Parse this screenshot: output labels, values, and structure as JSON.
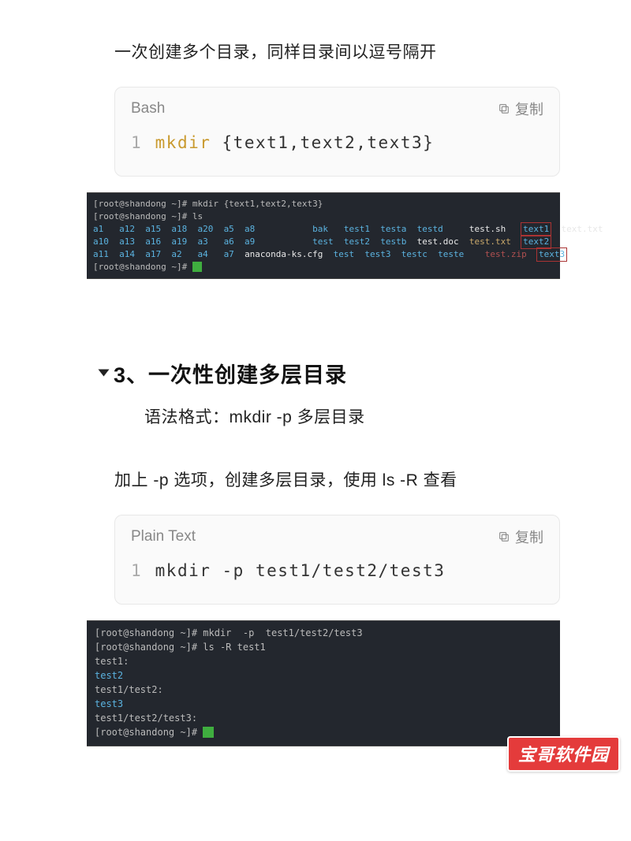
{
  "intro1": "一次创建多个目录，同样目录间以逗号隔开",
  "block1": {
    "lang": "Bash",
    "copy": "复制",
    "lineNo": "1",
    "cmd": "mkdir",
    "args": "{text1,text2,text3}"
  },
  "term1": {
    "l1": "[root@shandong ~]# mkdir {text1,text2,text3}",
    "l2": "[root@shandong ~]# ls",
    "row1": {
      "dirs": "a1   a12  a15  a18  a20  a5  a8           ",
      "bak": "bak   ",
      "t": "test1  testa  testd     ",
      "w": "test.sh   ",
      "hl": "text1",
      "end": "  text.txt"
    },
    "row2": {
      "dirs": "a10  a13  a16  a19  a3   a6  a9           ",
      "bak": "test  ",
      "t": "test2  testb  ",
      "doc": "test.doc  ",
      "txt": "test.txt  ",
      "hl": "text2"
    },
    "row3": {
      "dirs": "a11  a14  a17  a2   a4   a7  ",
      "ana": "anaconda-ks.cfg  ",
      "t": "test  test3  testc  teste    ",
      "zip": "test.zip  ",
      "hl": "text3"
    },
    "l6": "[root@shandong ~]# "
  },
  "section": {
    "title": "3、一次性创建多层目录",
    "syntax": "语法格式：mkdir -p  多层目录"
  },
  "intro2": "加上 -p 选项，创建多层目录，使用 ls -R 查看",
  "block2": {
    "lang": "Plain Text",
    "copy": "复制",
    "lineNo": "1",
    "code": "mkdir  -p  test1/test2/test3"
  },
  "term2": {
    "l1": "[root@shandong ~]# mkdir  -p  test1/test2/test3",
    "l2": "[root@shandong ~]# ls -R test1",
    "l3": "test1:",
    "l4": "test2",
    "l5": "",
    "l6": "test1/test2:",
    "l7": "test3",
    "l8": "",
    "l9": "test1/test2/test3:",
    "l10": "[root@shandong ~]# "
  },
  "watermark": "宝哥软件园"
}
